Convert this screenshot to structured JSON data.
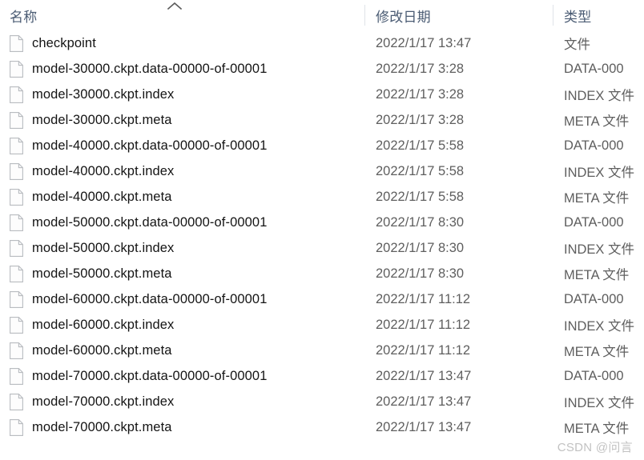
{
  "header": {
    "columns": [
      {
        "key": "name",
        "label": "名称",
        "sorted": true,
        "sort_direction": "ascending"
      },
      {
        "key": "date_modified",
        "label": "修改日期",
        "sorted": false
      },
      {
        "key": "type",
        "label": "类型",
        "sorted": false
      }
    ],
    "sort_icon": "chevron-up-icon",
    "header_text_color": "#4a5b73"
  },
  "list": {
    "item_icon": "file-icon",
    "rows": [
      {
        "name": "checkpoint",
        "date": "2022/1/17 13:47",
        "type": "文件"
      },
      {
        "name": "model-30000.ckpt.data-00000-of-00001",
        "date": "2022/1/17 3:28",
        "type": "DATA-000"
      },
      {
        "name": "model-30000.ckpt.index",
        "date": "2022/1/17 3:28",
        "type": "INDEX 文件"
      },
      {
        "name": "model-30000.ckpt.meta",
        "date": "2022/1/17 3:28",
        "type": "META 文件"
      },
      {
        "name": "model-40000.ckpt.data-00000-of-00001",
        "date": "2022/1/17 5:58",
        "type": "DATA-000"
      },
      {
        "name": "model-40000.ckpt.index",
        "date": "2022/1/17 5:58",
        "type": "INDEX 文件"
      },
      {
        "name": "model-40000.ckpt.meta",
        "date": "2022/1/17 5:58",
        "type": "META 文件"
      },
      {
        "name": "model-50000.ckpt.data-00000-of-00001",
        "date": "2022/1/17 8:30",
        "type": "DATA-000"
      },
      {
        "name": "model-50000.ckpt.index",
        "date": "2022/1/17 8:30",
        "type": "INDEX 文件"
      },
      {
        "name": "model-50000.ckpt.meta",
        "date": "2022/1/17 8:30",
        "type": "META 文件"
      },
      {
        "name": "model-60000.ckpt.data-00000-of-00001",
        "date": "2022/1/17 11:12",
        "type": "DATA-000"
      },
      {
        "name": "model-60000.ckpt.index",
        "date": "2022/1/17 11:12",
        "type": "INDEX 文件"
      },
      {
        "name": "model-60000.ckpt.meta",
        "date": "2022/1/17 11:12",
        "type": "META 文件"
      },
      {
        "name": "model-70000.ckpt.data-00000-of-00001",
        "date": "2022/1/17 13:47",
        "type": "DATA-000"
      },
      {
        "name": "model-70000.ckpt.index",
        "date": "2022/1/17 13:47",
        "type": "INDEX 文件"
      },
      {
        "name": "model-70000.ckpt.meta",
        "date": "2022/1/17 13:47",
        "type": "META 文件"
      }
    ]
  },
  "watermark": {
    "text": "CSDN @问言",
    "color": "#c2c2c2"
  }
}
